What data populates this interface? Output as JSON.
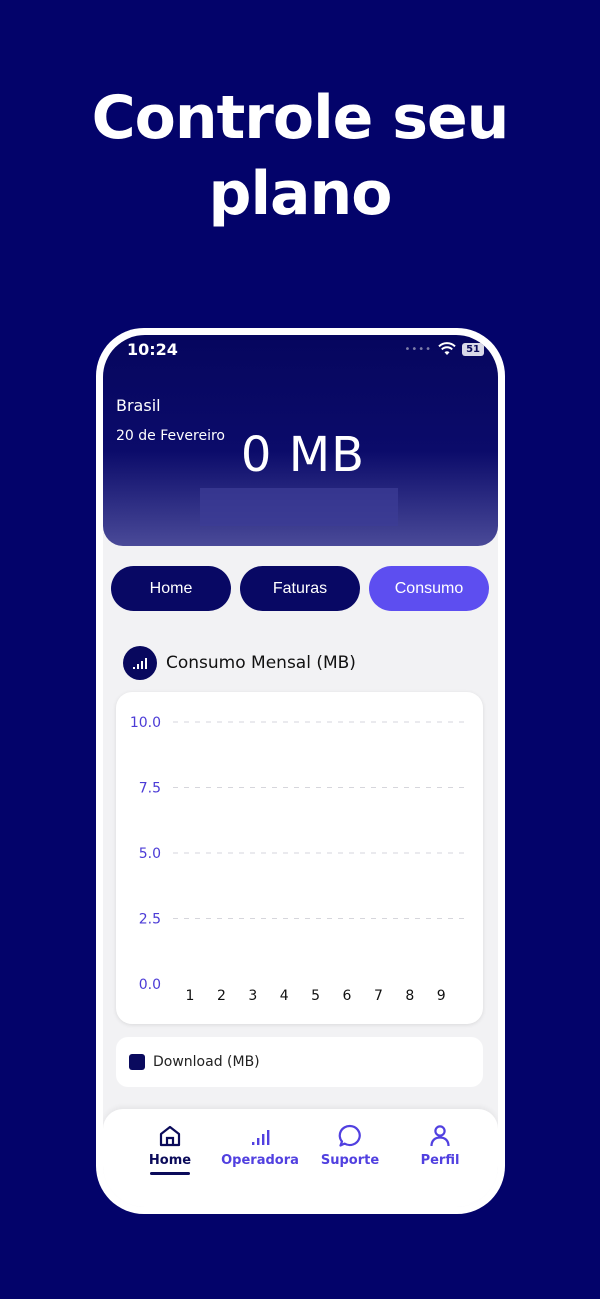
{
  "headline": {
    "line1": "Controle seu",
    "line2": "plano"
  },
  "status_bar": {
    "time": "10:24",
    "battery": "51"
  },
  "hero": {
    "country": "Brasil",
    "date": "20 de Fevereiro",
    "usage": "0 MB"
  },
  "tabs": [
    {
      "label": "Home",
      "active": false
    },
    {
      "label": "Faturas",
      "active": false
    },
    {
      "label": "Consumo",
      "active": true
    }
  ],
  "section": {
    "title": "Consumo Mensal (MB)",
    "icon": "signal-bars-icon"
  },
  "chart_data": {
    "type": "bar",
    "categories": [
      "1",
      "2",
      "3",
      "4",
      "5",
      "6",
      "7",
      "8",
      "9"
    ],
    "series": [
      {
        "name": "Download (MB)",
        "values": [
          0,
          0,
          0,
          0,
          0,
          0,
          0,
          0,
          0
        ]
      }
    ],
    "yticks": [
      "10.0",
      "7.5",
      "5.0",
      "2.5",
      "0.0"
    ],
    "ylim": [
      0,
      10
    ],
    "grid": true,
    "legend_position": "bottom",
    "colors": {
      "series": "#0a0a5e",
      "ytick": "#4b3bd6"
    }
  },
  "legend": {
    "label": "Download (MB)"
  },
  "bottom_nav": [
    {
      "label": "Home",
      "icon": "home-icon",
      "active": true
    },
    {
      "label": "Operadora",
      "icon": "signal-bars-icon",
      "active": false
    },
    {
      "label": "Suporte",
      "icon": "chat-bubble-icon",
      "active": false
    },
    {
      "label": "Perfil",
      "icon": "person-icon",
      "active": false
    }
  ],
  "colors": {
    "background": "#03036a",
    "accent": "#5d4ef0",
    "navy": "#080864"
  }
}
